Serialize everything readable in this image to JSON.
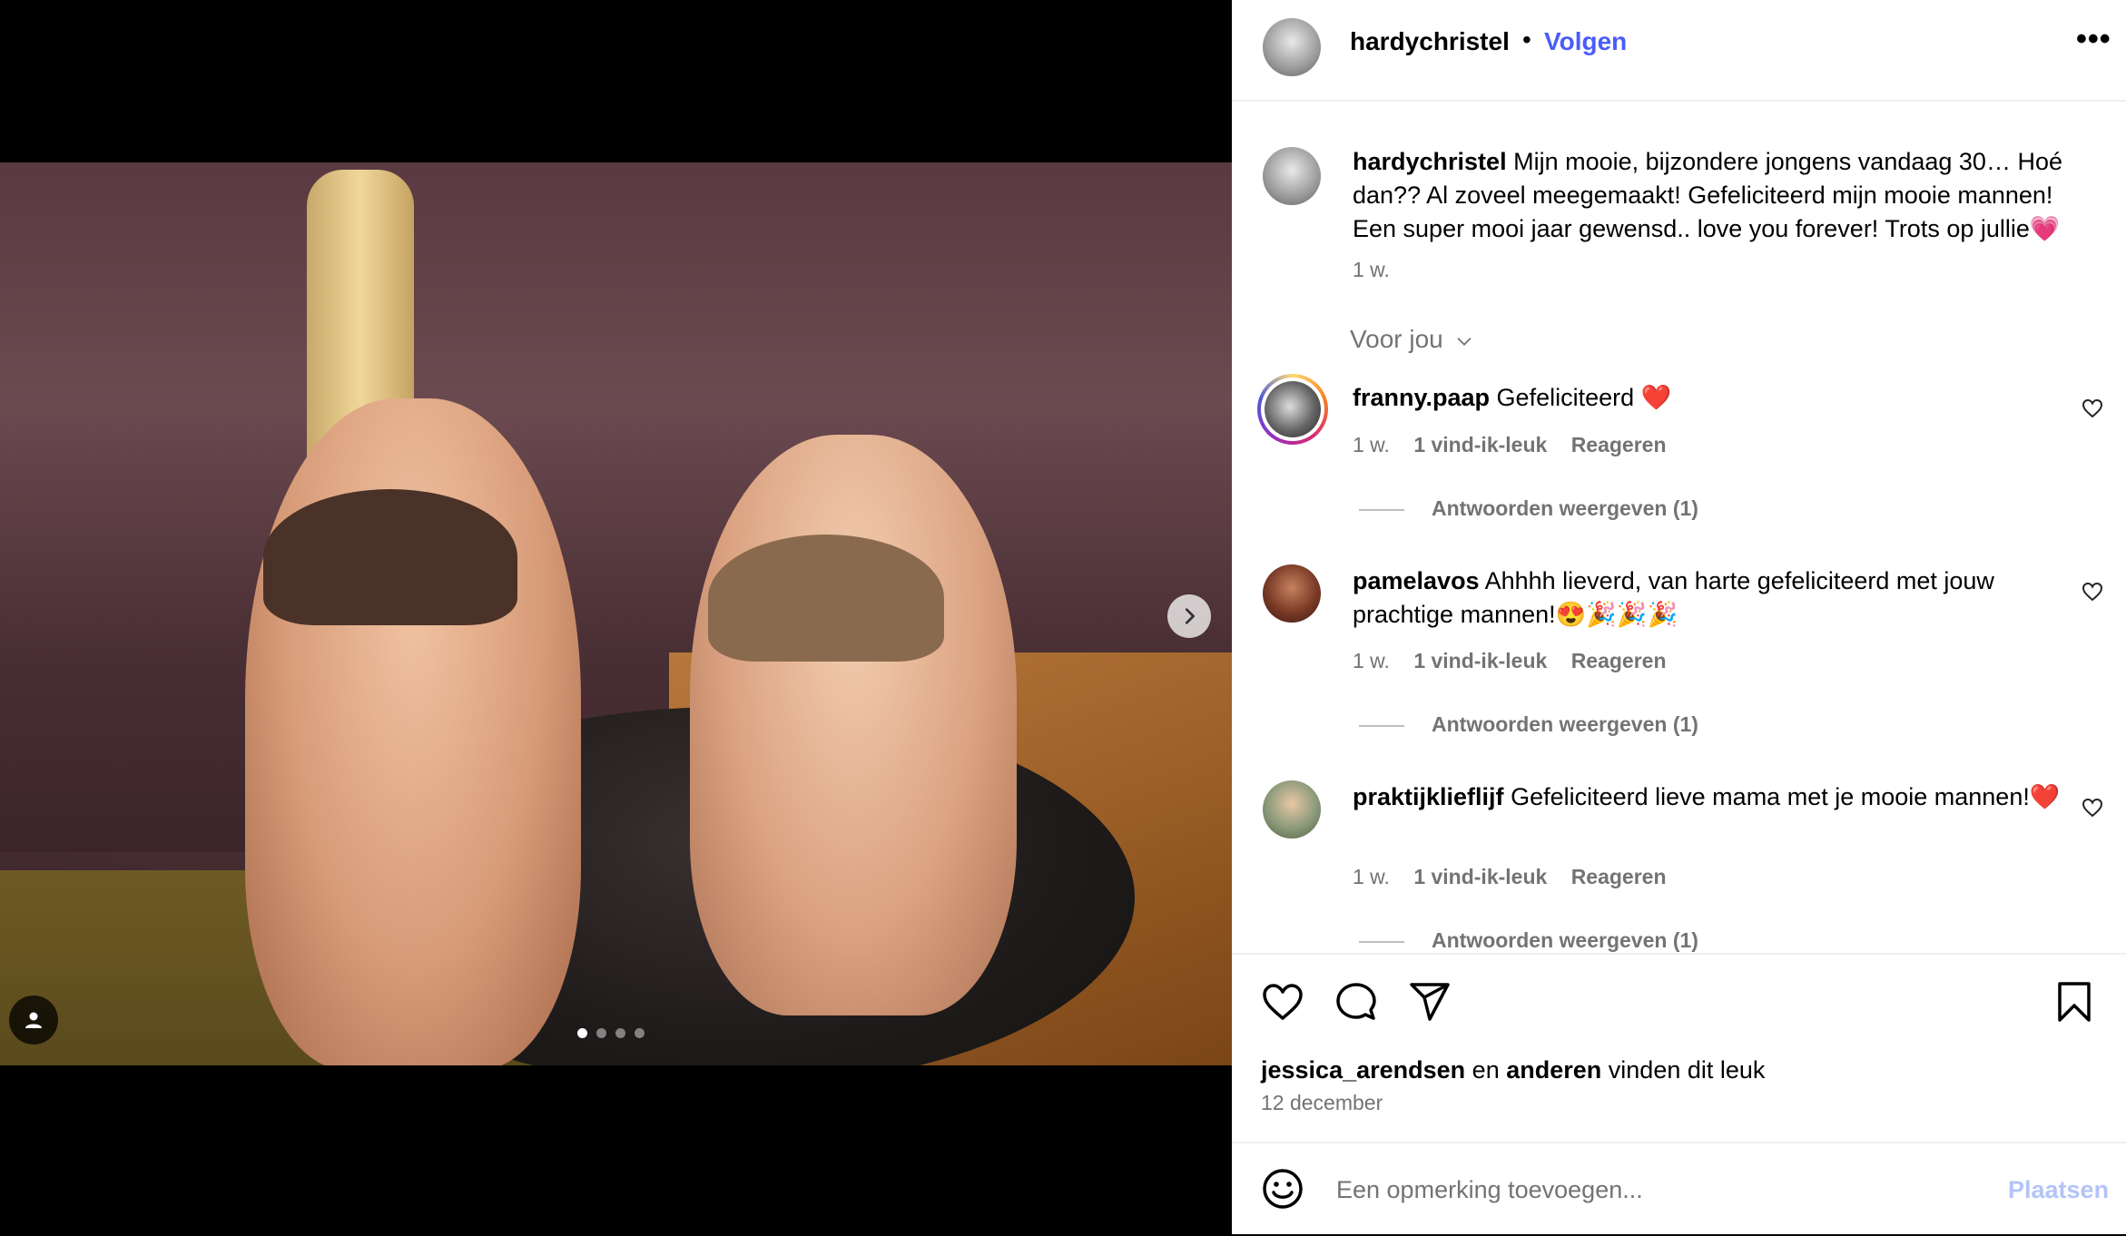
{
  "post": {
    "author": "hardychristel",
    "separator": "•",
    "follow_label": "Volgen",
    "more_icon_text": "•••",
    "carousel_count": 4,
    "carousel_active": 1
  },
  "caption": {
    "user": "hardychristel",
    "text": "Mijn mooie, bijzondere jongens vandaag 30… Hoé dan?? Al zoveel meegemaakt! Gefeliciteerd mijn mooie mannen! Een super mooi jaar gewensd.. love you forever! Trots op jullie💗",
    "time": "1 w."
  },
  "for_you_label": "Voor jou",
  "comments": [
    {
      "user": "franny.paap",
      "text": "Gefeliciteerd ❤️",
      "time": "1 w.",
      "likes": "1 vind-ik-leuk",
      "reply": "Reageren",
      "view_replies": "Antwoorden weergeven (1)"
    },
    {
      "user": "pamelavos",
      "text": "Ahhhh lieverd, van harte gefeliciteerd met jouw prachtige mannen!😍🎉🎉🎉",
      "time": "1 w.",
      "likes": "1 vind-ik-leuk",
      "reply": "Reageren",
      "view_replies": "Antwoorden weergeven (1)"
    },
    {
      "user": "praktijklieflijf",
      "text": "Gefeliciteerd lieve mama met je mooie mannen!❤️",
      "time": "1 w.",
      "likes": "1 vind-ik-leuk",
      "reply": "Reageren",
      "view_replies": "Antwoorden weergeven (1)"
    }
  ],
  "likes_summary": {
    "user": "jessica_arendsen",
    "middle": "en",
    "others": "anderen",
    "suffix": "vinden dit leuk"
  },
  "date": "12 december",
  "composer": {
    "placeholder": "Een opmerking toevoegen...",
    "post_label": "Plaatsen"
  },
  "colors": {
    "follow": "#4a5df9",
    "muted": "#737373",
    "post_disabled": "#b3c4f7"
  }
}
